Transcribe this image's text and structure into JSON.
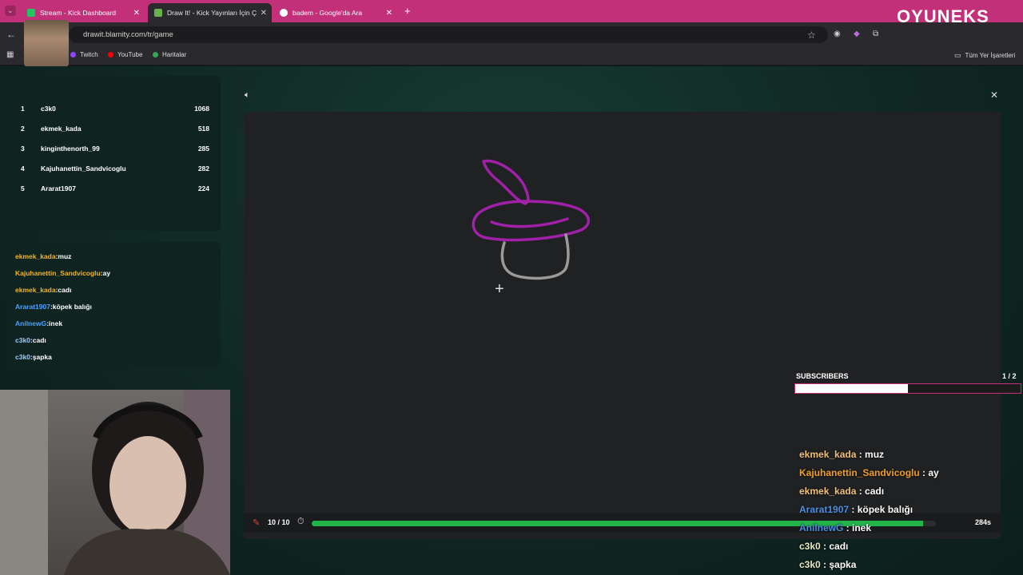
{
  "browser": {
    "tabs": [
      {
        "title": "Stream - Kick Dashboard",
        "favicon_color": "#22c55e",
        "active": false
      },
      {
        "title": "Draw It! - Kick Yayınları İçin Çizi",
        "favicon_color": "#6ab04c",
        "active": true
      },
      {
        "title": "badem - Google'da Ara",
        "favicon_color": "#ffffff",
        "active": false
      }
    ],
    "url": "drawit.blamity.com/tr/game",
    "bookmarks": [
      "Twitch",
      "YouTube",
      "Haritalar"
    ],
    "all_bookmarks": "Tüm Yer İşaretleri"
  },
  "watermark": "OYUNEKS",
  "leaderboard": [
    {
      "rank": "1",
      "name": "c3k0",
      "score": "1068"
    },
    {
      "rank": "2",
      "name": "ekmek_kada",
      "score": "518"
    },
    {
      "rank": "3",
      "name": "kinginthenorth_99",
      "score": "285"
    },
    {
      "rank": "4",
      "name": "Kajuhanettin_Sandvicoglu",
      "score": "282"
    },
    {
      "rank": "5",
      "name": "Ararat1907",
      "score": "224"
    }
  ],
  "chat": [
    {
      "user": "ekmek_kada",
      "msg": "muz",
      "color": "#f0b429"
    },
    {
      "user": "Kajuhanettin_Sandvicoglu",
      "msg": "ay",
      "color": "#f0b429"
    },
    {
      "user": "ekmek_kada",
      "msg": "cadı",
      "color": "#f0b429"
    },
    {
      "user": "Ararat1907",
      "msg": "köpek balığı",
      "color": "#4aa3ff"
    },
    {
      "user": "AnilnewG",
      "msg": "inek",
      "color": "#4aa3ff"
    },
    {
      "user": "c3k0",
      "msg": "cadı",
      "color": "#9ecbff"
    },
    {
      "user": "c3k0",
      "msg": "şapka",
      "color": "#9ecbff"
    }
  ],
  "overlay_chat": [
    {
      "user": "ekmek_kada",
      "msg": " : muz",
      "color": "#f0c27a"
    },
    {
      "user": "Kajuhanettin_Sandvicoglu",
      "msg": " : ay",
      "color": "#f0a020"
    },
    {
      "user": "ekmek_kada",
      "msg": " : cadı",
      "color": "#f0c27a"
    },
    {
      "user": "Ararat1907",
      "msg": " : köpek balığı",
      "color": "#4a90e2"
    },
    {
      "user": "AnilnewG",
      "msg": " : inek",
      "color": "#4a90e2"
    },
    {
      "user": "c3k0",
      "msg": " : cadı",
      "color": "#e8e8c0"
    },
    {
      "user": "c3k0",
      "msg": " : şapka",
      "color": "#e8e8c0"
    }
  ],
  "game": {
    "round": "10 / 10",
    "time_left": "284s",
    "time_fraction": 0.98
  },
  "subscribers": {
    "label": "SUBSCRIBERS",
    "count": "1 / 2",
    "fraction": 0.5
  }
}
